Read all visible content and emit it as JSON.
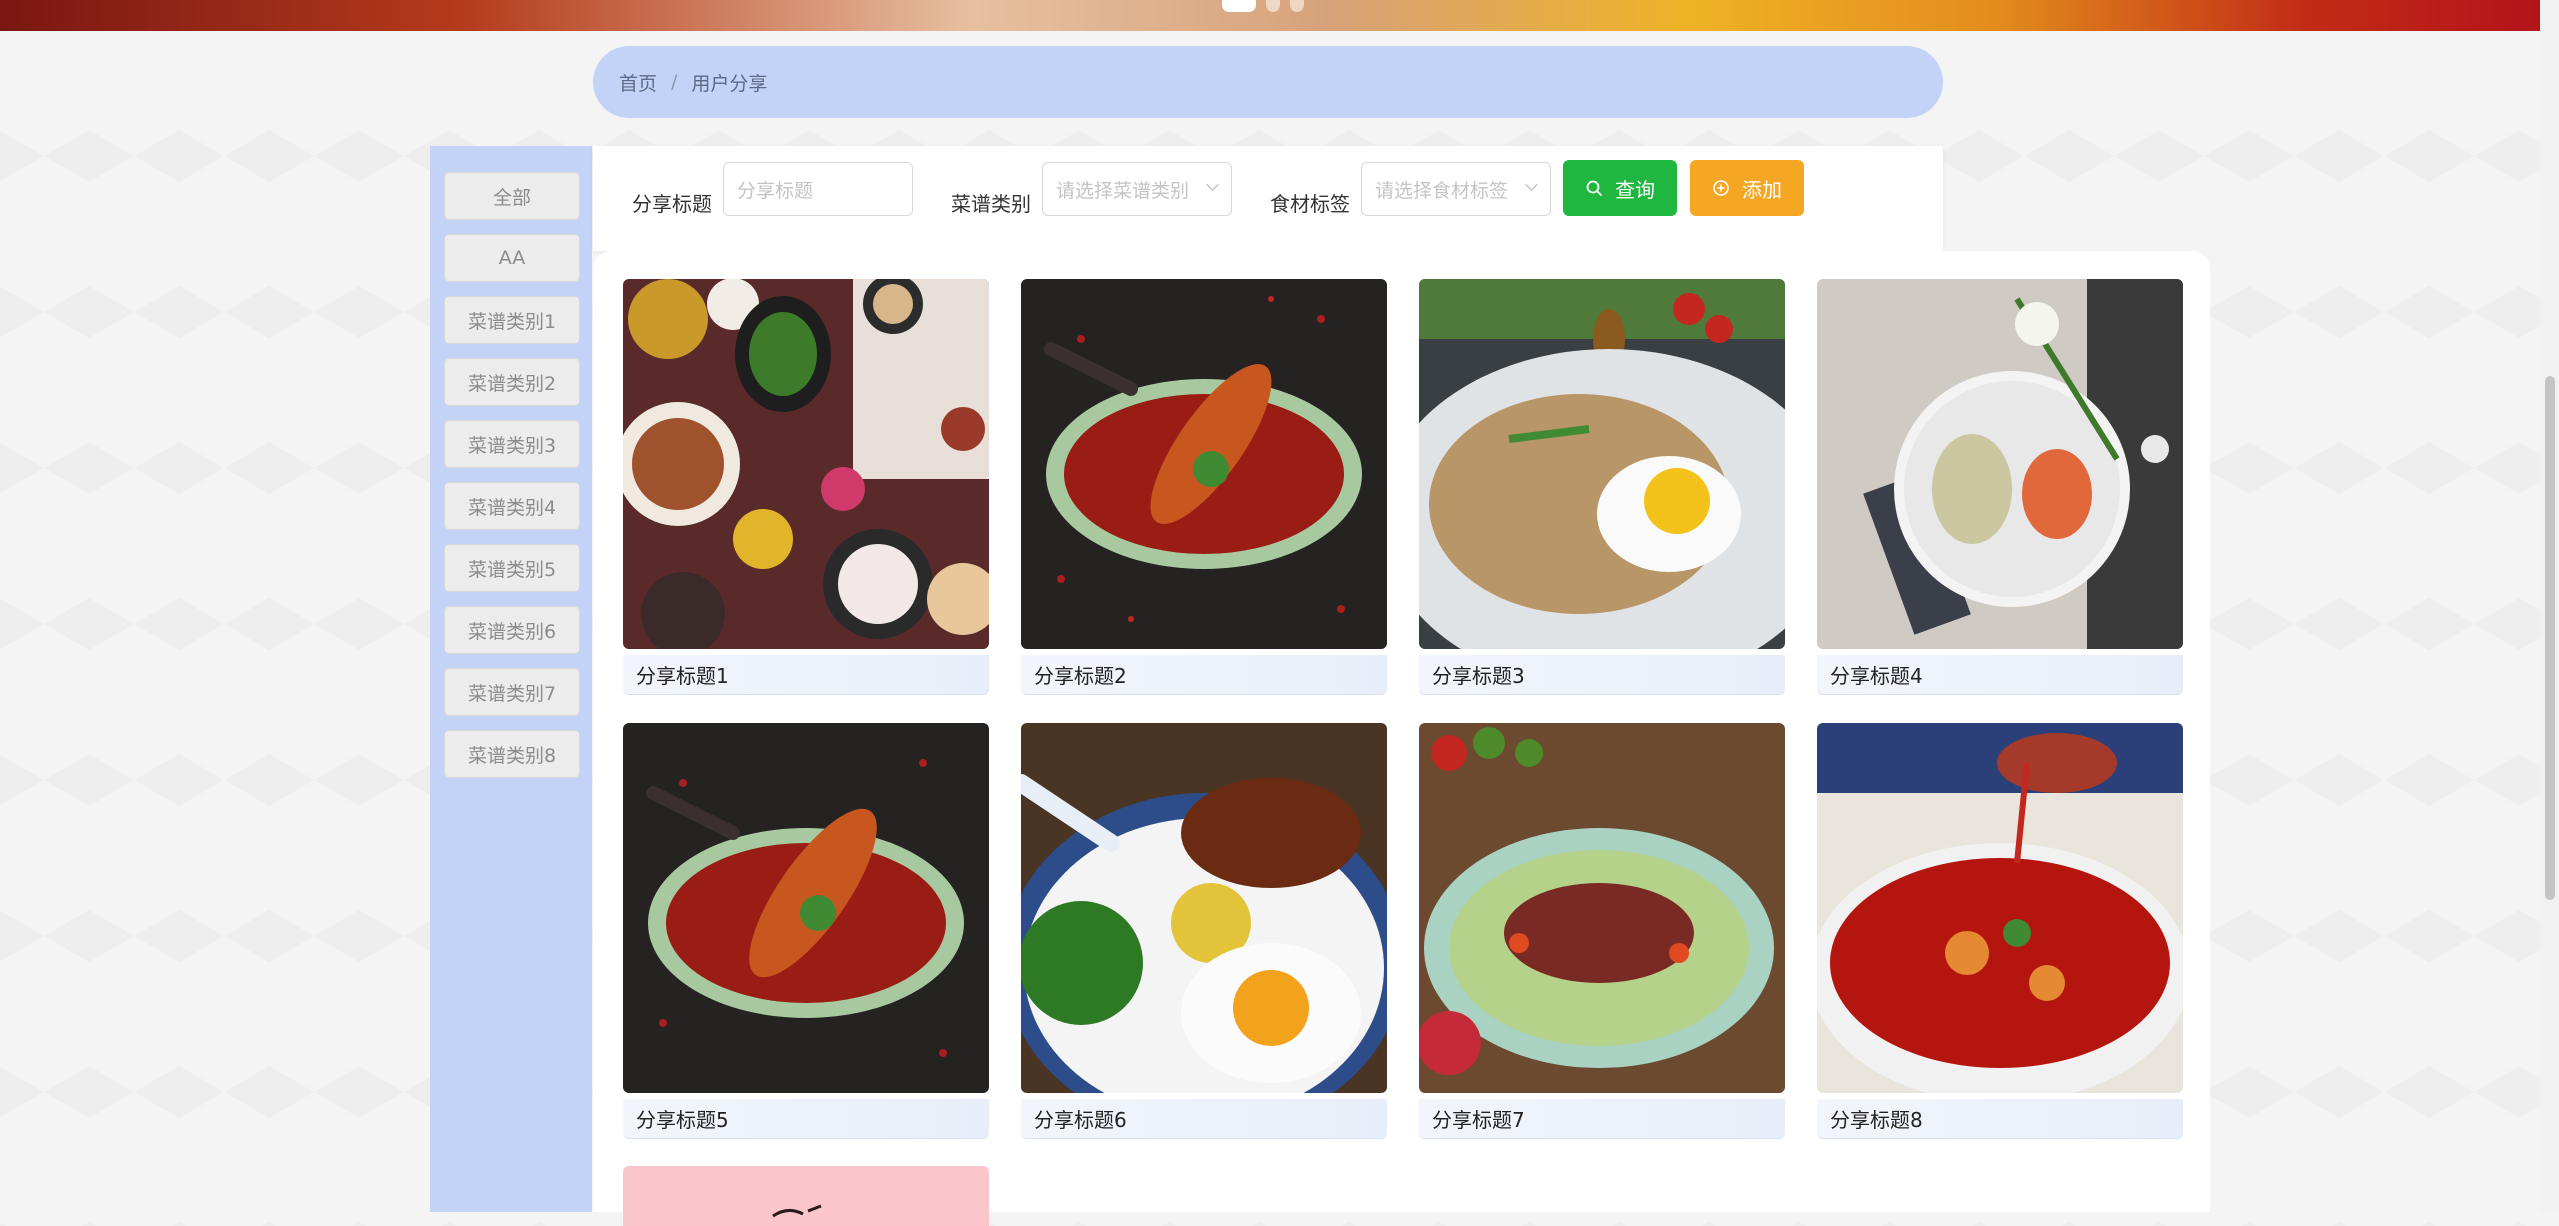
{
  "carousel": {
    "dots": 3,
    "active_index": 0
  },
  "breadcrumb": {
    "home": "首页",
    "separator": "/",
    "current": "用户分享"
  },
  "sidebar": {
    "items": [
      {
        "label": "全部"
      },
      {
        "label": "AA"
      },
      {
        "label": "菜谱类别1"
      },
      {
        "label": "菜谱类别2"
      },
      {
        "label": "菜谱类别3"
      },
      {
        "label": "菜谱类别4"
      },
      {
        "label": "菜谱类别5"
      },
      {
        "label": "菜谱类别6"
      },
      {
        "label": "菜谱类别7"
      },
      {
        "label": "菜谱类别8"
      }
    ]
  },
  "filters": {
    "title_label": "分享标题",
    "title_placeholder": "分享标题",
    "category_label": "菜谱类别",
    "category_placeholder": "请选择菜谱类别",
    "tag_label": "食材标签",
    "tag_placeholder": "请选择食材标签",
    "search_button": "查询",
    "add_button": "添加"
  },
  "cards": [
    {
      "title": "分享标题1",
      "image": "feast-table"
    },
    {
      "title": "分享标题2",
      "image": "lobster-chili"
    },
    {
      "title": "分享标题3",
      "image": "fried-rice-egg"
    },
    {
      "title": "分享标题4",
      "image": "shrimp-rice"
    },
    {
      "title": "分享标题5",
      "image": "lobster-chili"
    },
    {
      "title": "分享标题6",
      "image": "pork-rice-egg"
    },
    {
      "title": "分享标题7",
      "image": "beef-salad"
    },
    {
      "title": "分享标题8",
      "image": "spicy-fish"
    },
    {
      "title": "",
      "image": "pink-card"
    }
  ],
  "colors": {
    "accent": "#c3d3f7",
    "search": "#1fb73f",
    "add": "#f5a623"
  }
}
